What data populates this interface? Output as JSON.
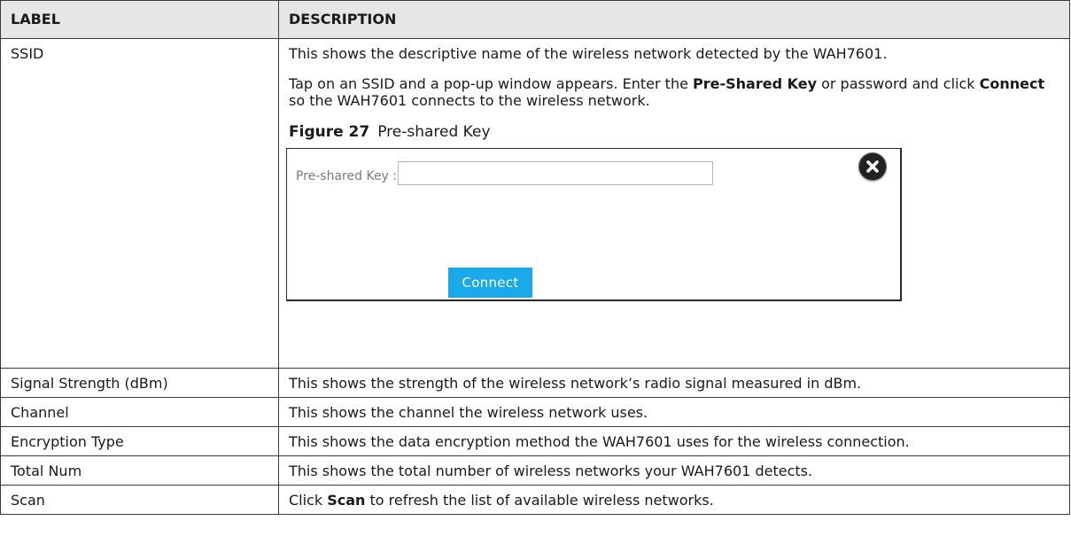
{
  "table": {
    "headers": [
      "LABEL",
      "DESCRIPTION"
    ],
    "rows": [
      {
        "label": "SSID",
        "para1": "This shows the descriptive name of the wireless network detected by the WAH7601.",
        "para2_parts": [
          "Tap on an SSID and a pop-up window appears. Enter the ",
          "Pre-Shared Key",
          " or password and click ",
          "Connect",
          " so the WAH7601 connects to the wireless network."
        ],
        "figure_number": "Figure 27",
        "figure_title": "Pre-shared Key",
        "dialog": {
          "psk_label": "Pre-shared Key :",
          "psk_value": "",
          "connect_label": "Connect",
          "accent_color": "#1ba9ea"
        }
      },
      {
        "label": "Signal Strength (dBm)",
        "description": "This shows the strength of the wireless network’s radio signal measured in dBm."
      },
      {
        "label": "Channel",
        "description": "This shows the channel the wireless network uses."
      },
      {
        "label": "Encryption Type",
        "description": "This shows the data encryption method the WAH7601 uses for the wireless connection."
      },
      {
        "label": "Total Num",
        "description": "This shows the total number of wireless networks your WAH7601 detects."
      },
      {
        "label": "Scan",
        "description_parts": [
          "Click ",
          "Scan",
          " to refresh the list of available wireless networks."
        ]
      }
    ]
  }
}
